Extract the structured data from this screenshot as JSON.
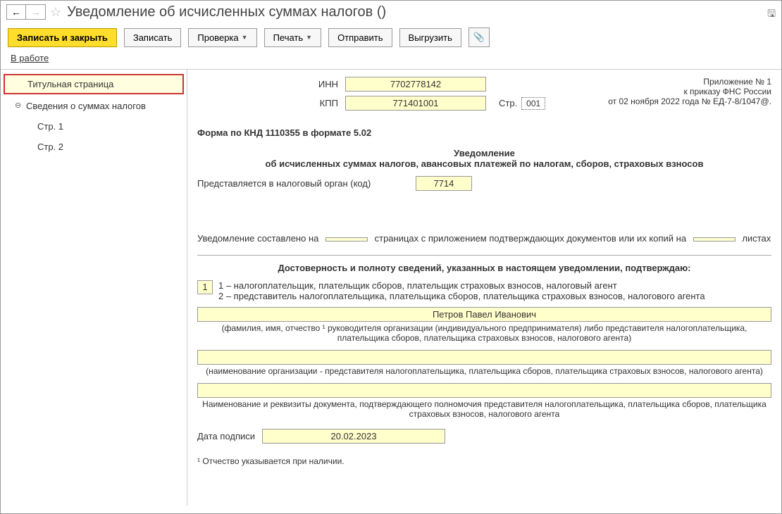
{
  "header": {
    "title": "Уведомление об исчисленных суммах налогов ()"
  },
  "toolbar": {
    "save_close": "Записать и закрыть",
    "save": "Записать",
    "check": "Проверка",
    "print": "Печать",
    "send": "Отправить",
    "export": "Выгрузить"
  },
  "status": {
    "text": "В работе"
  },
  "sidebar": {
    "title_page": "Титульная страница",
    "sums_info": "Сведения о суммах налогов",
    "page1": "Стр. 1",
    "page2": "Стр. 2"
  },
  "form": {
    "inn_label": "ИНН",
    "inn": "7702778142",
    "kpp_label": "КПП",
    "kpp": "771401001",
    "page_label": "Стр.",
    "page_num": "001",
    "appendix_line1": "Приложение № 1",
    "appendix_line2": "к приказу ФНС России",
    "appendix_line3": "от 02 ноября 2022 года № ЕД-7-8/1047@.",
    "knd_caption": "Форма по КНД 1110355 в формате 5.02",
    "doc_title": "Уведомление",
    "doc_subtitle": "об исчисленных суммах налогов, авансовых платежей по налогам, сборов, страховых взносов",
    "tax_authority_label": "Представляется в налоговый орган (код)",
    "tax_authority_code": "7714",
    "pages_prefix": "Уведомление составлено на",
    "pages_middle": "страницах с приложением подтверждающих документов или их копий на",
    "pages_suffix": "листах",
    "confirm_header": "Достоверность и полноту сведений, указанных в настоящем уведомлении, подтверждаю:",
    "confirm_code": "1",
    "confirm_opt1": "1 – налогоплательщик, плательщик сборов, плательщик страховых взносов, налоговый агент",
    "confirm_opt2": "2 – представитель налогоплательщика, плательщика сборов, плательщика страховых взносов, налогового агента",
    "signer_name": "Петров Павел Иванович",
    "signer_caption": "(фамилия, имя, отчество ¹ руководителя организации (индивидуального предпринимателя) либо представителя налогоплательщика, плательщика сборов, плательщика страховых взносов, налогового агента)",
    "org_caption": "(наименование организации - представителя налогоплательщика, плательщика сборов, плательщика страховых взносов, налогового агента)",
    "doc_caption": "Наименование и реквизиты документа, подтверждающего полномочия представителя налогоплательщика, плательщика сборов, плательщика страховых взносов, налогового агента",
    "sign_date_label": "Дата подписи",
    "sign_date": "20.02.2023",
    "footnote": "¹ Отчество указывается при наличии."
  }
}
